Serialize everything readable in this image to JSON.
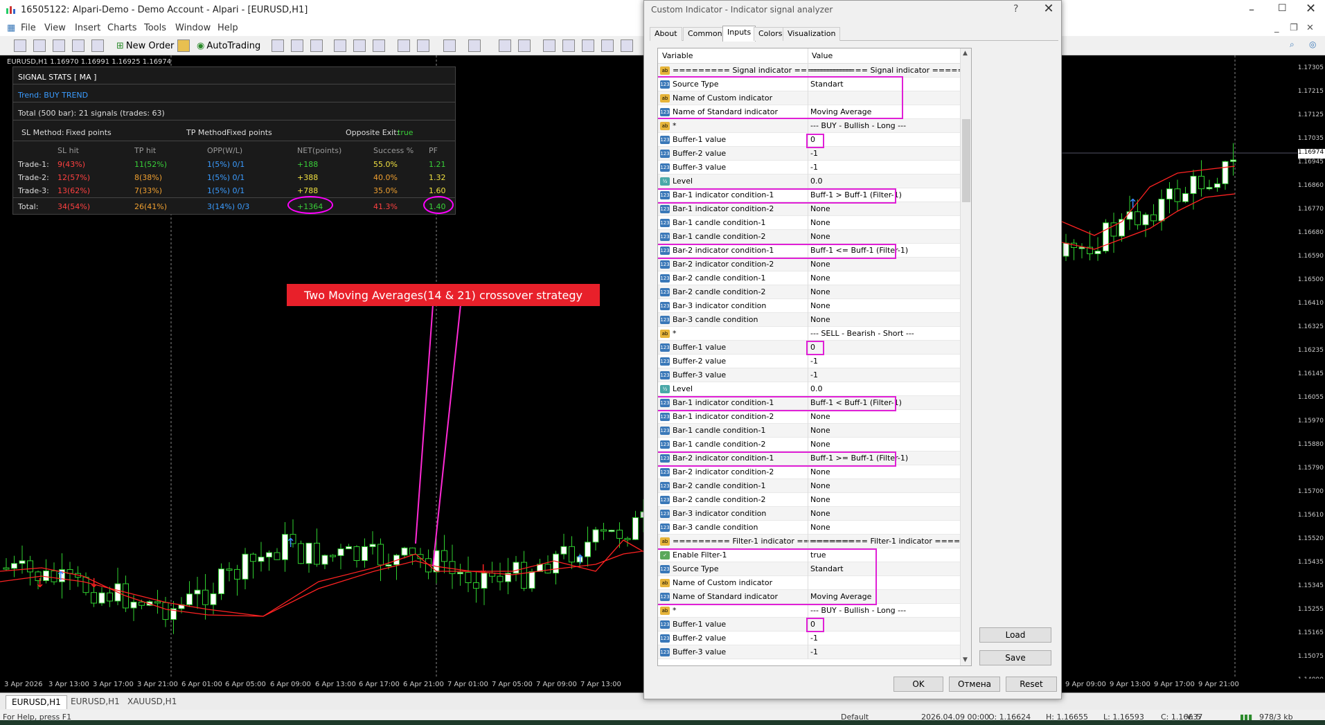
{
  "window": {
    "title": "16505122: Alpari-Demo - Demo Account - Alpari - [EURUSD,H1]"
  },
  "menu": [
    "File",
    "View",
    "Insert",
    "Charts",
    "Tools",
    "Window",
    "Help"
  ],
  "toolbar": {
    "new_order": "New Order",
    "autotrading": "AutoTrading"
  },
  "chart": {
    "info": "EURUSD,H1  1.16970 1.16991 1.16925 1.16974",
    "banner": "Two Moving Averages(14 & 21) crossover strategy",
    "price_labels": [
      "1.17305",
      "1.17215",
      "1.17125",
      "1.17035",
      "1.16945",
      "1.16860",
      "1.16770",
      "1.16680",
      "1.16590",
      "1.16500",
      "1.16410",
      "1.16325",
      "1.16235",
      "1.16145",
      "1.16055",
      "1.15970",
      "1.15880",
      "1.15790",
      "1.15700",
      "1.15610",
      "1.15520",
      "1.15435",
      "1.15345",
      "1.15255",
      "1.15165",
      "1.15075",
      "1.14990"
    ],
    "current_price": "1.16974",
    "time_labels": [
      "3 Apr 2026",
      "3 Apr 13:00",
      "3 Apr 17:00",
      "3 Apr 21:00",
      "6 Apr 01:00",
      "6 Apr 05:00",
      "6 Apr 09:00",
      "6 Apr 13:00",
      "6 Apr 17:00",
      "6 Apr 21:00",
      "7 Apr 01:00",
      "7 Apr 05:00",
      "7 Apr 09:00",
      "7 Apr 13:00",
      "9 Apr 09:00",
      "9 Apr 13:00",
      "9 Apr 17:00",
      "9 Apr 21:00"
    ]
  },
  "stats": {
    "title": "SIGNAL STATS [ MA ]",
    "trend": "Trend: BUY TREND",
    "total": "Total (500 bar): 21 signals (trades: 63)",
    "sl_label": "SL Method:",
    "sl_value": "Fixed points",
    "tp_label": "TP Method:",
    "tp_value": "Fixed points",
    "opp_label": "Opposite Exit:",
    "opp_value": "true",
    "headers": [
      "SL hit",
      "TP hit",
      "OPP(W/L)",
      "NET(points)",
      "Success %",
      "PF"
    ],
    "rows": [
      {
        "name": "Trade-1:",
        "sl": "9(43%)",
        "tp": "11(52%)",
        "opp": "1(5%) 0/1",
        "net": "+188",
        "succ": "55.0%",
        "pf": "1.21"
      },
      {
        "name": "Trade-2:",
        "sl": "12(57%)",
        "tp": "8(38%)",
        "opp": "1(5%) 0/1",
        "net": "+388",
        "succ": "40.0%",
        "pf": "1.32"
      },
      {
        "name": "Trade-3:",
        "sl": "13(62%)",
        "tp": "7(33%)",
        "opp": "1(5%) 0/1",
        "net": "+788",
        "succ": "35.0%",
        "pf": "1.60"
      },
      {
        "name": "Total:",
        "sl": "34(54%)",
        "tp": "26(41%)",
        "opp": "3(14%) 0/3",
        "net": "+1364",
        "succ": "41.3%",
        "pf": "1.40"
      }
    ]
  },
  "dialog": {
    "title": "Custom Indicator - Indicator signal analyzer",
    "help": "?",
    "tabs": [
      "About",
      "Common",
      "Inputs",
      "Colors",
      "Visualization"
    ],
    "col_variable": "Variable",
    "col_value": "Value",
    "load": "Load",
    "save": "Save",
    "ok": "OK",
    "cancel": "Отмена",
    "reset": "Reset",
    "rows": [
      {
        "ic": "ab",
        "var": "========= Signal indicator =========",
        "val": "========= Signal indicator ========="
      },
      {
        "ic": "123",
        "var": "Source Type",
        "val": "Standart"
      },
      {
        "ic": "ab",
        "var": "Name of Custom indicator",
        "val": ""
      },
      {
        "ic": "123",
        "var": "Name of Standard indicator",
        "val": "Moving Average"
      },
      {
        "ic": "ab",
        "var": "*",
        "val": "--- BUY - Bullish - Long ---"
      },
      {
        "ic": "123",
        "var": "Buffer-1 value",
        "val": "0"
      },
      {
        "ic": "123",
        "var": "Buffer-2 value",
        "val": "-1"
      },
      {
        "ic": "123",
        "var": "Buffer-3 value",
        "val": "-1"
      },
      {
        "ic": "fx",
        "var": "Level",
        "val": "0.0"
      },
      {
        "ic": "123",
        "var": "Bar-1 indicator condition-1",
        "val": "Buff-1 > Buff-1 (Filter-1)"
      },
      {
        "ic": "123",
        "var": "Bar-1 indicator condition-2",
        "val": "None"
      },
      {
        "ic": "123",
        "var": "Bar-1 candle condition-1",
        "val": "None"
      },
      {
        "ic": "123",
        "var": "Bar-1 candle condition-2",
        "val": "None"
      },
      {
        "ic": "123",
        "var": "Bar-2 indicator condition-1",
        "val": "Buff-1 <= Buff-1 (Filter-1)"
      },
      {
        "ic": "123",
        "var": "Bar-2 indicator condition-2",
        "val": "None"
      },
      {
        "ic": "123",
        "var": "Bar-2 candle condition-1",
        "val": "None"
      },
      {
        "ic": "123",
        "var": "Bar-2 candle condition-2",
        "val": "None"
      },
      {
        "ic": "123",
        "var": "Bar-3 indicator condition",
        "val": "None"
      },
      {
        "ic": "123",
        "var": "Bar-3 candle condition",
        "val": "None"
      },
      {
        "ic": "ab",
        "var": "*",
        "val": "--- SELL - Bearish - Short ---"
      },
      {
        "ic": "123",
        "var": "Buffer-1 value",
        "val": "0"
      },
      {
        "ic": "123",
        "var": "Buffer-2 value",
        "val": "-1"
      },
      {
        "ic": "123",
        "var": "Buffer-3 value",
        "val": "-1"
      },
      {
        "ic": "fx",
        "var": "Level",
        "val": "0.0"
      },
      {
        "ic": "123",
        "var": "Bar-1 indicator condition-1",
        "val": "Buff-1 < Buff-1 (Filter-1)"
      },
      {
        "ic": "123",
        "var": "Bar-1 indicator condition-2",
        "val": "None"
      },
      {
        "ic": "123",
        "var": "Bar-1 candle condition-1",
        "val": "None"
      },
      {
        "ic": "123",
        "var": "Bar-1 candle condition-2",
        "val": "None"
      },
      {
        "ic": "123",
        "var": "Bar-2 indicator condition-1",
        "val": "Buff-1 >= Buff-1 (Filter-1)"
      },
      {
        "ic": "123",
        "var": "Bar-2 indicator condition-2",
        "val": "None"
      },
      {
        "ic": "123",
        "var": "Bar-2 candle condition-1",
        "val": "None"
      },
      {
        "ic": "123",
        "var": "Bar-2 candle condition-2",
        "val": "None"
      },
      {
        "ic": "123",
        "var": "Bar-3 indicator condition",
        "val": "None"
      },
      {
        "ic": "123",
        "var": "Bar-3 candle condition",
        "val": "None"
      },
      {
        "ic": "ab",
        "var": "========= Filter-1 indicator =========",
        "val": "========= Filter-1 indicator ========="
      },
      {
        "ic": "tf",
        "var": "Enable Filter-1",
        "val": "true"
      },
      {
        "ic": "123",
        "var": "Source Type",
        "val": "Standart"
      },
      {
        "ic": "ab",
        "var": "Name of Custom indicator",
        "val": ""
      },
      {
        "ic": "123",
        "var": "Name of Standard indicator",
        "val": "Moving Average"
      },
      {
        "ic": "ab",
        "var": "*",
        "val": "--- BUY - Bullish - Long ---"
      },
      {
        "ic": "123",
        "var": "Buffer-1 value",
        "val": "0"
      },
      {
        "ic": "123",
        "var": "Buffer-2 value",
        "val": "-1"
      },
      {
        "ic": "123",
        "var": "Buffer-3 value",
        "val": "-1"
      }
    ]
  },
  "tabs": [
    "EURUSD,H1",
    "EURUSD,H1",
    "XAUUSD,H1"
  ],
  "status": {
    "help": "For Help, press F1",
    "profile": "Default",
    "date": "2026.04.09 00:00",
    "o": "O: 1.16624",
    "h": "H: 1.16655",
    "l": "L: 1.16593",
    "c": "C: 1.16637",
    "v": "V: 5",
    "traffic": "978/3 kb"
  }
}
